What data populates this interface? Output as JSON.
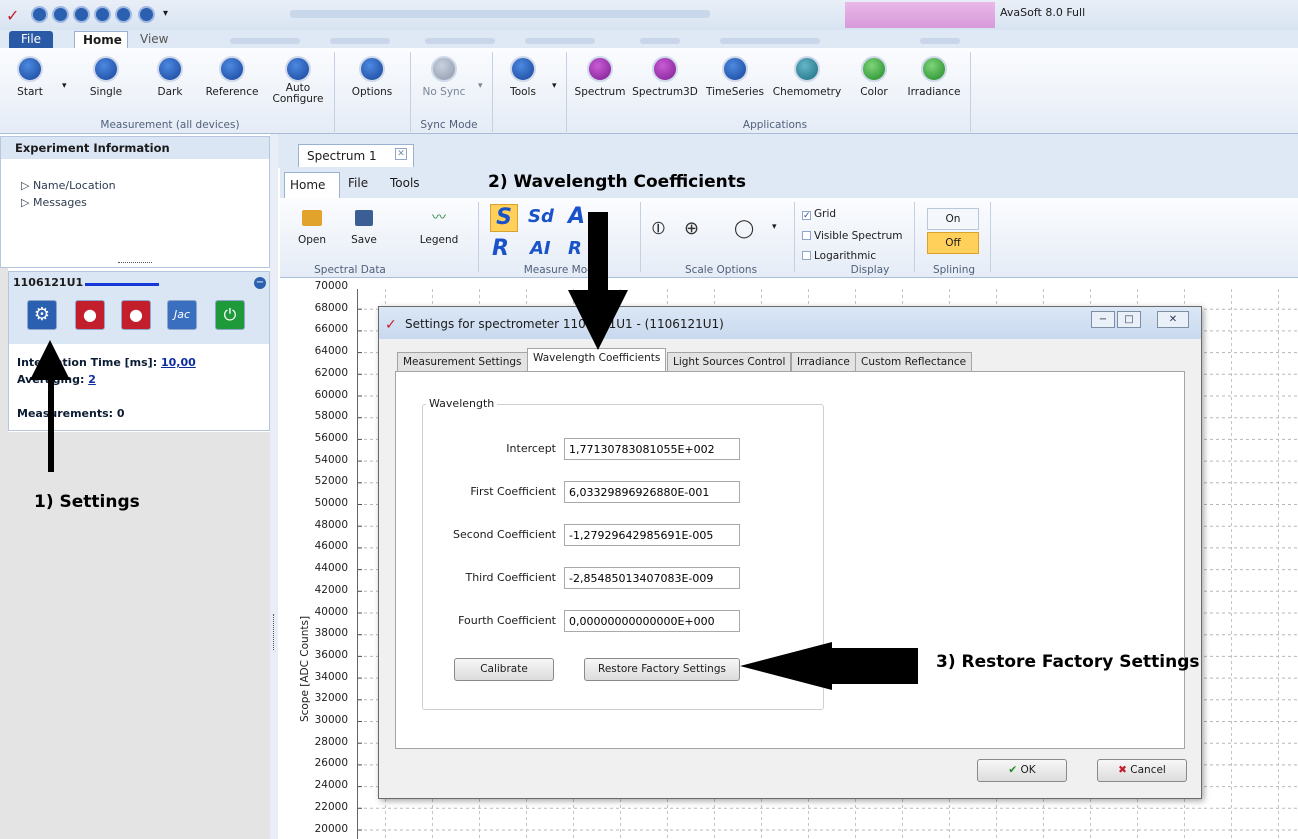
{
  "window": {
    "title": "AvaSoft 8.0 Full"
  },
  "ribbon_tabs": {
    "file": "File",
    "home": "Home",
    "view": "View"
  },
  "ribbon": {
    "buttons": [
      {
        "label": "Start",
        "icon": "play-icon"
      },
      {
        "label": "Single",
        "icon": "single-icon"
      },
      {
        "label": "Dark",
        "icon": "dark-bulb-icon"
      },
      {
        "label": "Reference",
        "icon": "reference-bulb-icon"
      },
      {
        "label": "Auto\nConfigure",
        "icon": "auto-configure-icon"
      },
      {
        "label": "Options",
        "icon": "options-wrench-icon"
      },
      {
        "label": "No Sync",
        "icon": "sync-icon"
      },
      {
        "label": "Tools",
        "icon": "tools-icon"
      },
      {
        "label": "Spectrum",
        "icon": "spectrum-icon"
      },
      {
        "label": "Spectrum3D",
        "icon": "spectrum3d-icon"
      },
      {
        "label": "TimeSeries",
        "icon": "timeseries-icon"
      },
      {
        "label": "Chemometry",
        "icon": "chemometry-icon"
      },
      {
        "label": "Color",
        "icon": "color-icon"
      },
      {
        "label": "Irradiance",
        "icon": "irradiance-icon"
      }
    ],
    "groups": {
      "measurement": "Measurement (all devices)",
      "sync": "Sync Mode",
      "applications": "Applications"
    }
  },
  "experiment": {
    "header": "Experiment Information",
    "items": [
      "▷ Name/Location",
      "▷ Messages"
    ]
  },
  "device": {
    "id": "1106121U1",
    "integration_label": "Integration Time  [ms]:",
    "integration_value": "10,00",
    "averaging_label": "Averaging:",
    "averaging_value": "2",
    "measurements_label": "Measurements: 0"
  },
  "spectrum": {
    "tab": "Spectrum 1",
    "subtabs": {
      "home": "Home",
      "file": "File",
      "tools": "Tools"
    },
    "buttons": {
      "open": "Open",
      "save": "Save",
      "legend": "Legend"
    },
    "groups": {
      "spectral": "Spectral Data",
      "measure": "Measure Mode",
      "scale": "Scale Options",
      "display": "Display",
      "splining": "Splining"
    },
    "checks": {
      "grid": "Grid",
      "visible": "Visible Spectrum",
      "log": "Logarithmic"
    },
    "splining_on": "On",
    "splining_off": "Off"
  },
  "chart_data": {
    "type": "line",
    "ylabel": "Scope [ADC Counts]",
    "yticks": [
      "70000",
      "68000",
      "66000",
      "64000",
      "62000",
      "60000",
      "58000",
      "56000",
      "54000",
      "52000",
      "50000",
      "48000",
      "46000",
      "44000",
      "42000",
      "40000",
      "38000",
      "36000",
      "34000",
      "32000",
      "30000",
      "28000",
      "26000",
      "24000",
      "22000",
      "20000"
    ],
    "grid": true
  },
  "dialog": {
    "title": "Settings for spectrometer 1106121U1 - (1106121U1)",
    "tabs": [
      "Measurement Settings",
      "Wavelength Coefficients",
      "Light Sources Control",
      "Irradiance",
      "Custom Reflectance"
    ],
    "group": "Wavelength",
    "fields": [
      {
        "label": "Intercept",
        "value": "1,77130783081055E+002"
      },
      {
        "label": "First Coefficient",
        "value": "6,03329896926880E-001"
      },
      {
        "label": "Second Coefficient",
        "value": "-1,27929642985691E-005"
      },
      {
        "label": "Third Coefficient",
        "value": "-2,85485013407083E-009"
      },
      {
        "label": "Fourth Coefficient",
        "value": "0,00000000000000E+000"
      }
    ],
    "calibrate": "Calibrate",
    "restore": "Restore Factory Settings",
    "ok": "OK",
    "cancel": "Cancel"
  },
  "annotations": {
    "settings": "1) Settings",
    "wavelength": "2) Wavelength Coefficients",
    "restore": "3) Restore Factory Settings"
  }
}
